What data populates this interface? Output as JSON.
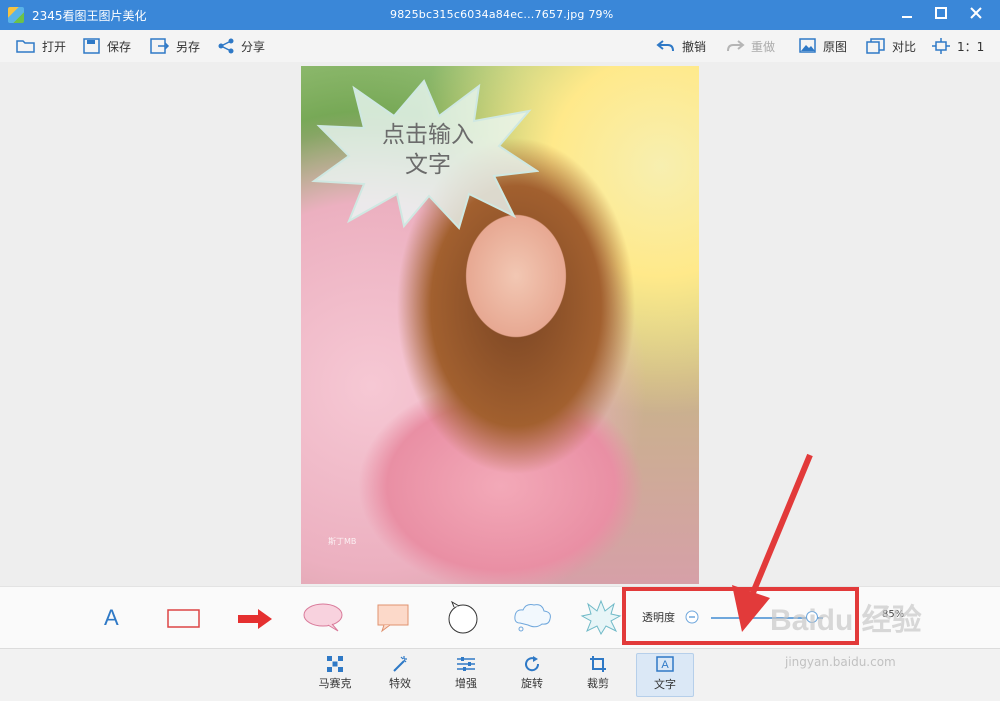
{
  "window": {
    "app_title": "2345看图王图片美化",
    "file_title": "9825bc315c6034a84ec...7657.jpg  79%"
  },
  "toolbar": {
    "open": "打开",
    "save": "保存",
    "save_as": "另存",
    "share": "分享",
    "undo": "撤销",
    "redo": "重做",
    "original": "原图",
    "compare": "对比",
    "ratio": "1：1"
  },
  "canvas": {
    "bubble_text_line1": "点击输入",
    "bubble_text_line2": "文字",
    "photo_mark": "斯丁MB"
  },
  "sticker_strip": {
    "text_sticker_label": "A",
    "opacity_label": "透明度",
    "opacity_value": "85%",
    "opacity_fraction": 0.85
  },
  "bottom_tools": [
    {
      "label": "马赛克",
      "icon": "mosaic-icon"
    },
    {
      "label": "特效",
      "icon": "magic-wand-icon"
    },
    {
      "label": "增强",
      "icon": "sliders-icon"
    },
    {
      "label": "旋转",
      "icon": "rotate-icon"
    },
    {
      "label": "裁剪",
      "icon": "crop-icon"
    },
    {
      "label": "文字",
      "icon": "text-icon"
    }
  ],
  "watermark": {
    "brand": "Baidu 经验",
    "url": "jingyan.baidu.com"
  },
  "colors": {
    "title_bar": "#3a87d8",
    "accent": "#2f79c6",
    "highlight_red": "#e23a3a"
  }
}
